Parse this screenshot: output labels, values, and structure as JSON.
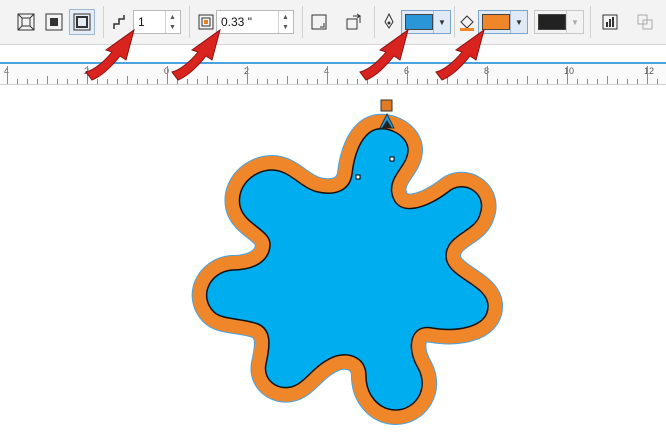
{
  "toolbar": {
    "outline_steps_value": "1",
    "outline_width_value": "0.33 \"",
    "outline_color": "#2a96d8",
    "fill_color": "#f0862a",
    "dim_color": "#222222",
    "icons": [
      "square-markers-icon",
      "square-inner-icon",
      "square-outer-icon",
      "steps-icon",
      "contour-offset-icon",
      "corner-icon",
      "convert-icon",
      "pen-icon",
      "fill-bucket-icon",
      "lock-icon",
      "copy-icon"
    ]
  },
  "ruler": {
    "labels": [
      "4",
      "2",
      "0",
      "2",
      "4",
      "6",
      "8",
      "10",
      "12"
    ]
  },
  "canvas": {
    "shape_fill": "#00adef",
    "shape_outline": "#f0862a",
    "arrow_color": "#d61f1f"
  }
}
